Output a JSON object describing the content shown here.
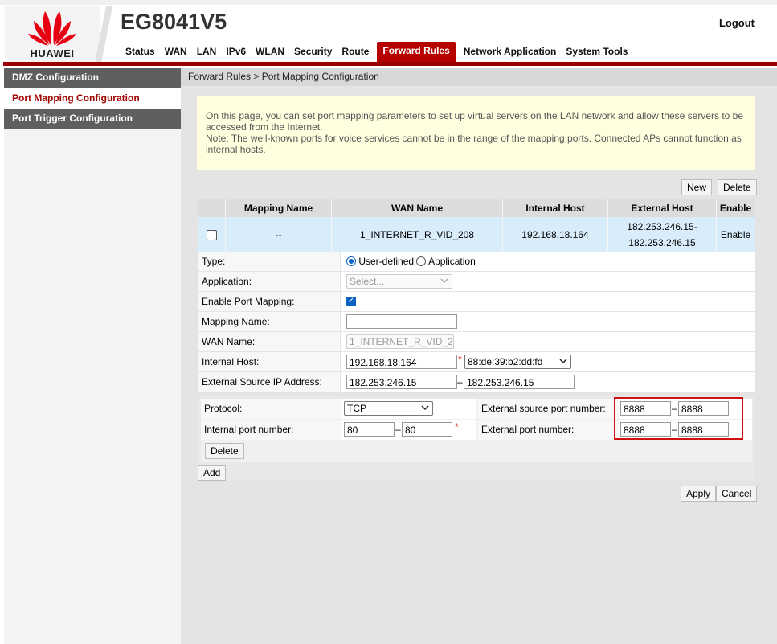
{
  "header": {
    "brand": "HUAWEI",
    "model": "EG8041V5",
    "logout": "Logout",
    "nav": [
      "Status",
      "WAN",
      "LAN",
      "IPv6",
      "WLAN",
      "Security",
      "Route",
      "Forward Rules",
      "Network Application",
      "System Tools"
    ],
    "active_nav": "Forward Rules"
  },
  "sidebar": {
    "items": [
      "DMZ Configuration",
      "Port Mapping Configuration",
      "Port Trigger Configuration"
    ],
    "active": "Port Mapping Configuration"
  },
  "breadcrumb": "Forward Rules > Port Mapping Configuration",
  "notice": {
    "line1": "On this page, you can set port mapping parameters to set up virtual servers on the LAN network and allow these servers to be accessed from the Internet.",
    "line2": "Note: The well-known ports for voice services cannot be in the range of the mapping ports. Connected APs cannot function as internal hosts."
  },
  "buttons": {
    "new": "New",
    "delete": "Delete",
    "port_delete": "Delete",
    "add": "Add",
    "apply": "Apply",
    "cancel": "Cancel"
  },
  "table": {
    "headers": [
      "",
      "Mapping Name",
      "WAN Name",
      "Internal Host",
      "External Host",
      "Enable"
    ],
    "row": {
      "mapping_name": "--",
      "wan_name": "1_INTERNET_R_VID_208",
      "internal_host": "192.168.18.164",
      "external_host_1": "182.253.246.15-",
      "external_host_2": "182.253.246.15",
      "enable": "Enable"
    }
  },
  "form": {
    "type_label": "Type:",
    "type_user": "User-defined",
    "type_app": "Application",
    "application_label": "Application:",
    "application_placeholder": "Select...",
    "enable_label": "Enable Port Mapping:",
    "mapping_name_label": "Mapping Name:",
    "mapping_name_value": "",
    "wan_name_label": "WAN Name:",
    "wan_name_value": "1_INTERNET_R_VID_2",
    "internal_host_label": "Internal Host:",
    "internal_host_value": "192.168.18.164",
    "internal_host_mac": "88:de:39:b2:dd:fd",
    "ext_src_ip_label": "External Source IP Address:",
    "ext_src_ip_start": "182.253.246.15",
    "ext_src_ip_end": "182.253.246.15",
    "asterisk": "*",
    "dash": "–"
  },
  "ports": {
    "protocol_label": "Protocol:",
    "protocol_value": "TCP",
    "ext_src_port_label": "External source port number:",
    "ext_src_port_start": "8888",
    "ext_src_port_end": "8888",
    "int_port_label": "Internal port number:",
    "int_port_start": "80",
    "int_port_end": "80",
    "ext_port_label": "External port number:",
    "ext_port_start": "8888",
    "ext_port_end": "8888"
  },
  "colors": {
    "brand_red": "#b60000",
    "highlight": "#d01010",
    "row_blue": "#d9ecfa",
    "notice_yellow": "#ffffe0"
  }
}
